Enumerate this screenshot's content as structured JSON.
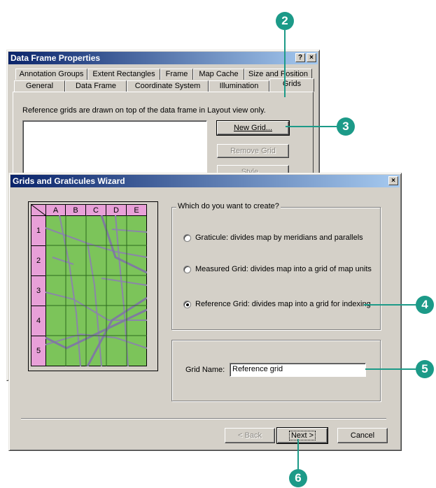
{
  "callouts": {
    "c2": "2",
    "c3": "3",
    "c4": "4",
    "c5": "5",
    "c6": "6"
  },
  "data_frame": {
    "title": "Data Frame Properties",
    "help_btn": "?",
    "close_btn": "×",
    "tabs_back": [
      "Annotation Groups",
      "Extent Rectangles",
      "Frame",
      "Map Cache",
      "Size and Position"
    ],
    "tabs_front": [
      "General",
      "Data Frame",
      "Coordinate System",
      "Illumination",
      "Grids"
    ],
    "info_text": "Reference grids are drawn on top of the data frame in Layout view only.",
    "new_grid": "New Grid...",
    "remove_grid": "Remove Grid",
    "style_btn": "Style..."
  },
  "wizard": {
    "title": "Grids and Graticules Wizard",
    "close_btn": "×",
    "group_label": "Which do you want to create?",
    "options": [
      {
        "label": "Graticule: divides map by meridians and parallels",
        "checked": false
      },
      {
        "label": "Measured Grid: divides map into a grid of map units",
        "checked": false
      },
      {
        "label": "Reference Grid: divides map into a grid for indexing",
        "checked": true
      }
    ],
    "grid_name_label": "Grid Name:",
    "grid_name_value": "Reference grid",
    "back_btn": "< Back",
    "next_btn": "Next >",
    "cancel_btn": "Cancel",
    "preview_cols": [
      "A",
      "B",
      "C",
      "D",
      "E"
    ],
    "preview_rows": [
      "1",
      "2",
      "3",
      "4",
      "5"
    ]
  },
  "colors": {
    "callout": "#1c9a88",
    "map_green": "#7cc45a",
    "header_pink": "#e8a0d8",
    "title_blue": "#0a246a"
  }
}
